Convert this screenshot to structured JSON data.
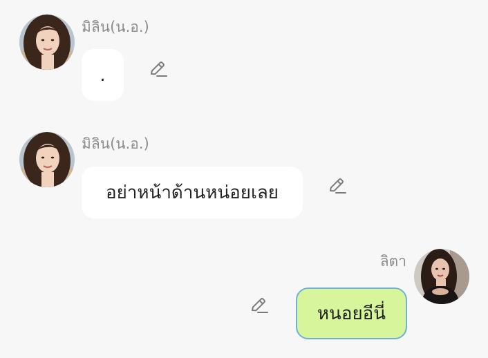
{
  "messages": [
    {
      "sender": "มิลิน(น.อ.)",
      "text": ".",
      "avatar_icon": "avatar-milin",
      "edit_icon": "pencil-icon"
    },
    {
      "sender": "มิลิน(น.อ.)",
      "text": "อย่าหน้าด้านหน่อยเลย",
      "avatar_icon": "avatar-milin",
      "edit_icon": "pencil-icon"
    },
    {
      "sender": "ลิตา",
      "text": "หนอยอีนี่",
      "avatar_icon": "avatar-lita",
      "edit_icon": "pencil-icon"
    }
  ],
  "colors": {
    "background": "#f7f7f7",
    "incoming_bubble": "#ffffff",
    "outgoing_bubble": "#d7f59a",
    "outgoing_border": "#6cb1dc",
    "sender_text": "#8d8d8d",
    "icon": "#7a7a7a"
  }
}
